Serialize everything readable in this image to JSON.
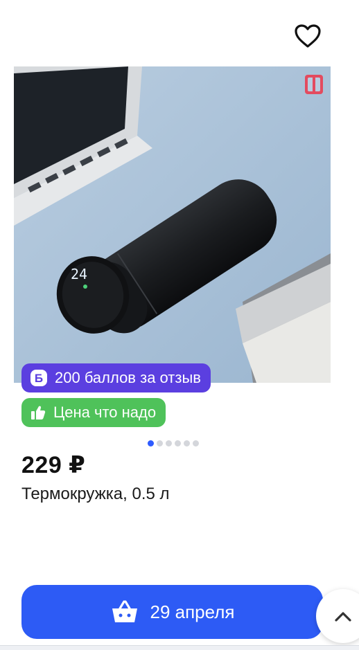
{
  "product": {
    "image_alt": "Термокружка",
    "display_temp": "24",
    "price": "229 ₽",
    "title": "Термокружка, 0.5 л"
  },
  "badges": {
    "points": "200 баллов за отзыв",
    "points_icon_letter": "Б",
    "price": "Цена что надо"
  },
  "carousel": {
    "total": 6,
    "active": 1
  },
  "buy": {
    "label": "29 апреля"
  },
  "icons": {
    "favorite": "heart-icon",
    "basket": "basket-icon",
    "scroll_top": "chevron-up-icon",
    "thumb": "thumbs-up-icon"
  },
  "colors": {
    "accent": "#2d5bf5",
    "points_badge": "#5b3fe0",
    "price_badge": "#4fc25a"
  }
}
